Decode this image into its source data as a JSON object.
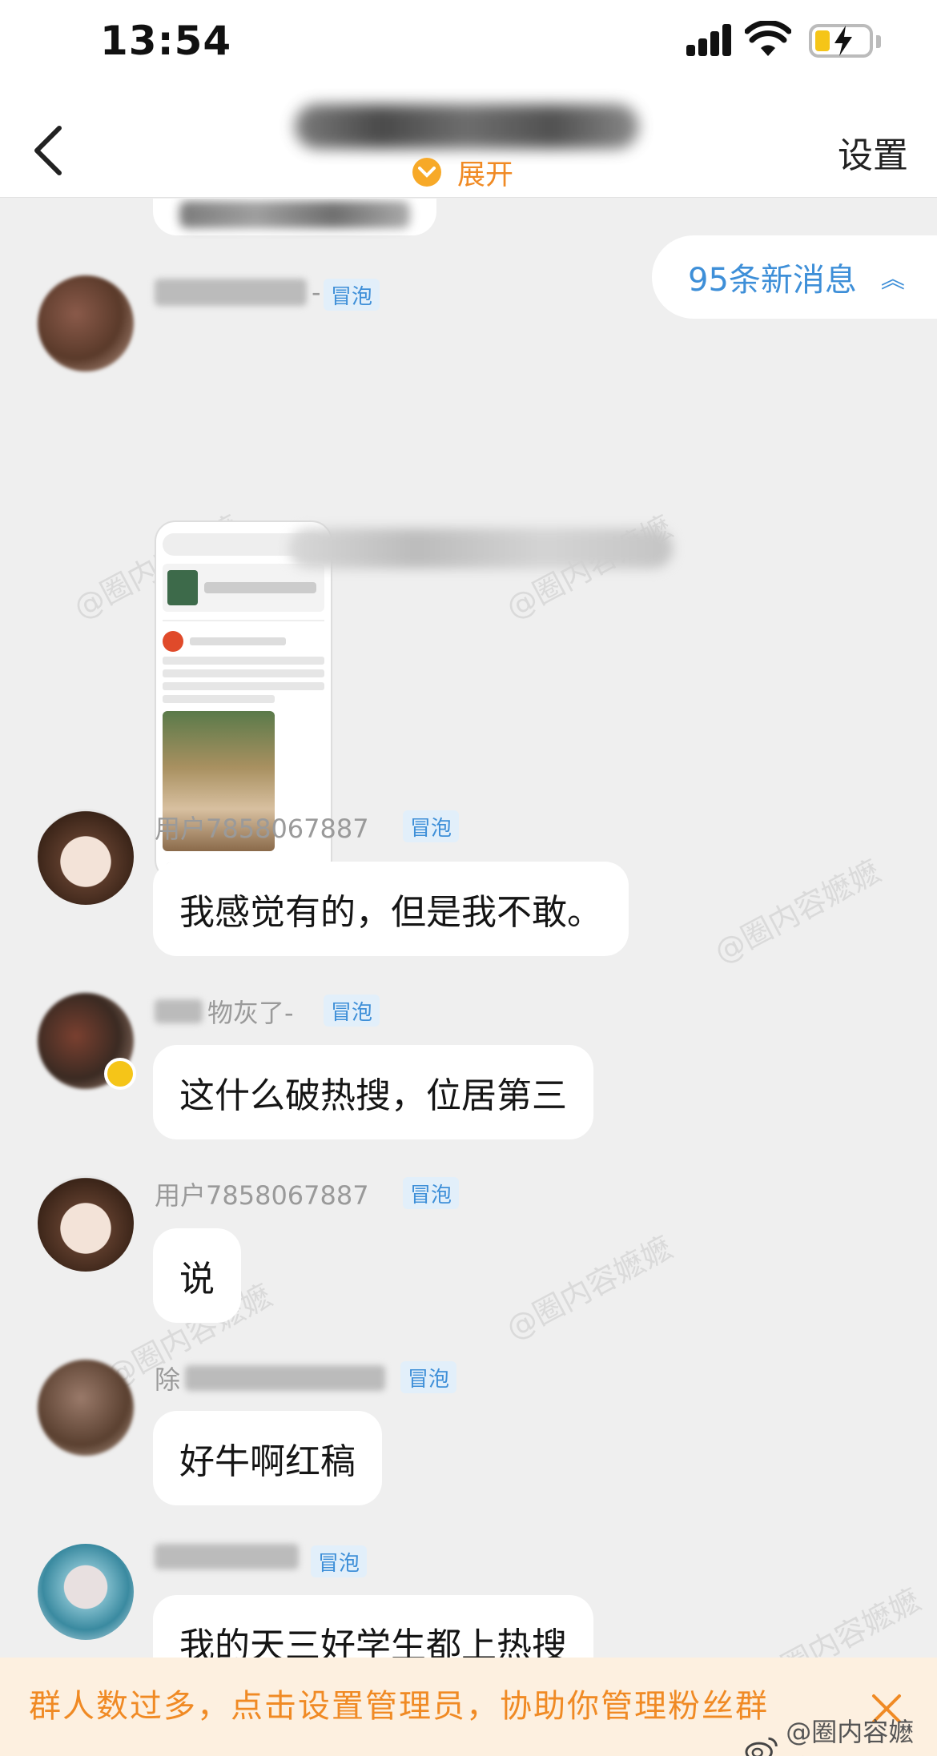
{
  "status_bar": {
    "time": "13:54"
  },
  "nav": {
    "expand_label": "展开",
    "settings_label": "设置"
  },
  "new_messages": {
    "label": "95条新消息",
    "chevron": "︽"
  },
  "messages": [
    {
      "sender_partial": "-",
      "badge": "冒泡"
    },
    {
      "sender": "用户7858067887",
      "badge": "冒泡",
      "text": "我感觉有的，但是我不敢。"
    },
    {
      "sender_partial": "物灰了-",
      "badge": "冒泡",
      "text": "这什么破热搜，位居第三"
    },
    {
      "sender": "用户7858067887",
      "badge": "冒泡",
      "text": "说"
    },
    {
      "sender_partial": "除",
      "badge": "冒泡",
      "text": "好牛啊红稿"
    },
    {
      "sender_partial": "",
      "badge": "冒泡",
      "text": "我的天三好学生都上热搜"
    }
  ],
  "watermark": "@圈内容嬷嬷",
  "banner": {
    "text": "群人数过多，点击设置管理员，协助你管理粉丝群",
    "close_icon": "close-icon"
  },
  "weibo_credit": "@圈内容嬷嬷",
  "colors": {
    "accent_orange": "#f08a24",
    "link_blue": "#3e8fd8",
    "chat_bg": "#efefef"
  }
}
